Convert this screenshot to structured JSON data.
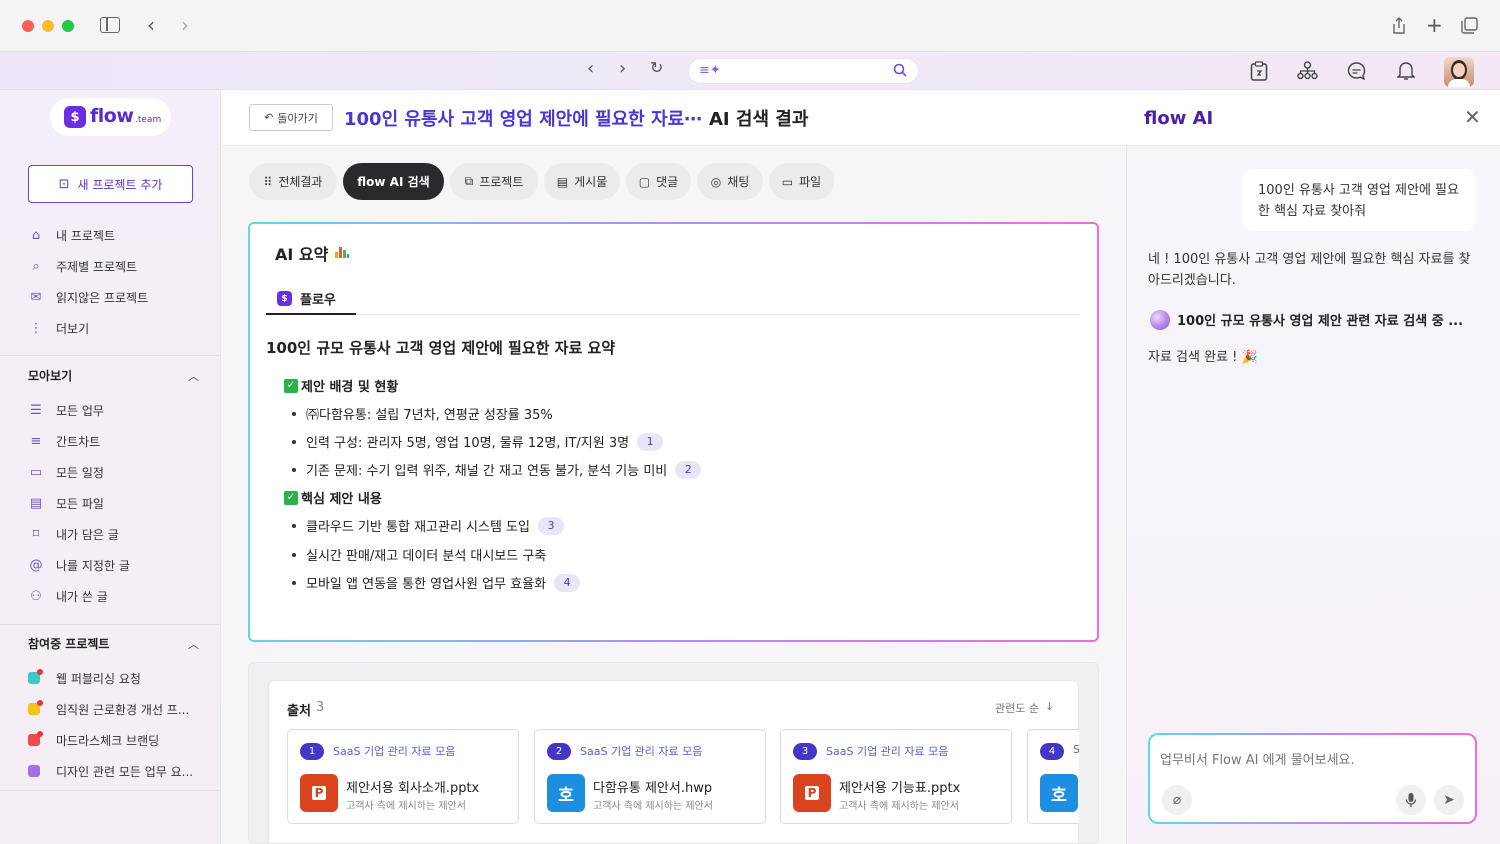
{
  "search": {
    "placeholder": ""
  },
  "sidebar": {
    "logo_text": "flow",
    "logo_suffix": ".team",
    "new_project": "새 프로젝트 추가",
    "nav": [
      {
        "label": "내 프로젝트",
        "icon": "home-icon"
      },
      {
        "label": "주제별 프로젝트",
        "icon": "search-icon"
      },
      {
        "label": "읽지않은 프로젝트",
        "icon": "mail-icon"
      },
      {
        "label": "더보기",
        "icon": "more-vertical-icon"
      }
    ],
    "collect_title": "모아보기",
    "collect": [
      {
        "label": "모든 업무",
        "icon": "list-icon"
      },
      {
        "label": "간트차트",
        "icon": "gantt-icon"
      },
      {
        "label": "모든 일정",
        "icon": "calendar-icon"
      },
      {
        "label": "모든 파일",
        "icon": "file-icon"
      },
      {
        "label": "내가 담은 글",
        "icon": "bookmark-icon"
      },
      {
        "label": "나를 지정한 글",
        "icon": "at-icon"
      },
      {
        "label": "내가 쓴 글",
        "icon": "user-list-icon"
      }
    ],
    "projects_title": "참여중 프로젝트",
    "projects": [
      {
        "label": "웹 퍼블리싱 요청",
        "color": "#3ec9c2",
        "dot": "#e33"
      },
      {
        "label": "임직원 근로환경 개선 프...",
        "color": "#f5c21a",
        "dot": "#e33"
      },
      {
        "label": "마드라스체크 브랜딩",
        "color": "#ee4b4b",
        "dot": "#e33"
      },
      {
        "label": "디자인 관련 모든 업무 요...",
        "color": "#a66ee8",
        "dot": ""
      }
    ]
  },
  "header": {
    "back": "돌아가기",
    "query": "100인 유통사 고객 영업 제안에 필요한 자료⋯",
    "suffix": "AI 검색 결과"
  },
  "tabs": [
    {
      "label": "전체결과",
      "icon": "grid-icon"
    },
    {
      "label": "flow AI 검색",
      "icon": ""
    },
    {
      "label": "프로젝트",
      "icon": "copy-icon"
    },
    {
      "label": "게시물",
      "icon": "post-icon"
    },
    {
      "label": "댓글",
      "icon": "comment-icon"
    },
    {
      "label": "채팅",
      "icon": "chat-icon"
    },
    {
      "label": "파일",
      "icon": "folder-icon"
    }
  ],
  "summary": {
    "title": "AI 요약",
    "tab": "플로우",
    "heading": "100인 규모 유통사 고객 영업 제안에 필요한 자료 요약",
    "sec1": "제안 배경 및 현황",
    "sec1_items": [
      {
        "text": "㈜다함유통: 설립 7년차, 연평균 성장률 35%",
        "ref": ""
      },
      {
        "text": "인력 구성: 관리자 5명, 영업 10명, 물류 12명, IT/지원 3명",
        "ref": "1"
      },
      {
        "text": "기존 문제: 수기 입력 위주, 채널 간 재고 연동 불가, 분석 기능 미비",
        "ref": "2"
      }
    ],
    "sec2": "핵심 제안 내용",
    "sec2_items": [
      {
        "text": "클라우드 기반 통합 재고관리 시스템 도입",
        "ref": "3"
      },
      {
        "text": "실시간 판매/재고 데이터 분석 대시보드 구축",
        "ref": ""
      },
      {
        "text": "모바일 앱 연동을 통한 영업사원 업무 효율화",
        "ref": "4"
      }
    ]
  },
  "sources": {
    "title": "출처",
    "count": "3",
    "sort": "관련도 순",
    "cards": [
      {
        "num": "1",
        "collection": "SaaS 기업 관리 자료 모음",
        "file": "제안서용 회사소개.pptx",
        "desc": "고객사 측에 제시하는 제안서",
        "type": "P",
        "color": "#d9431e"
      },
      {
        "num": "2",
        "collection": "SaaS 기업 관리 자료 모음",
        "file": "다함유통 제안서.hwp",
        "desc": "고객사 측에 제시하는 제안서",
        "type": "호",
        "color": "#1e8fe0"
      },
      {
        "num": "3",
        "collection": "SaaS 기업 관리 자료 모음",
        "file": "제안서용 기능표.pptx",
        "desc": "고객사 측에 제시하는 제안서",
        "type": "P",
        "color": "#d9431e"
      },
      {
        "num": "4",
        "collection": "S",
        "file": "",
        "desc": "",
        "type": "호",
        "color": "#1e8fe0"
      }
    ]
  },
  "ai_panel": {
    "title": "flow AI",
    "user_msg": "100인 유통사 고객 영업 제안에 필요한 핵심 자료 찾아줘",
    "reply": "네 ! 100인 유통사 고객 영업 제안에 필요한 핵심 자료를 찾아드리겠습니다.",
    "status": "100인 규모 유통사 영업 제안 관련 자료 검색 중 ...",
    "done": "자료 검색 완료 ! 🎉",
    "input_placeholder": "업무비서 Flow AI 에게 물어보세요."
  }
}
